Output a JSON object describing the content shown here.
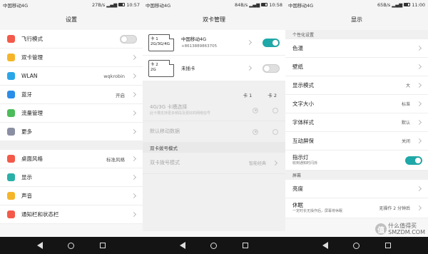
{
  "screen1": {
    "status": {
      "carrier": "中国移动4G",
      "speed": "27B/s",
      "time": "10:57"
    },
    "title": "设置",
    "group1": [
      {
        "label": "飞行模式",
        "icon": "airplane-icon",
        "color": "#f35a4a",
        "toggle": "off"
      },
      {
        "label": "双卡管理",
        "icon": "sim-icon",
        "color": "#f5b52a"
      },
      {
        "label": "WLAN",
        "value": "wqkrobin",
        "icon": "wifi-icon",
        "color": "#2aa6e8"
      },
      {
        "label": "蓝牙",
        "value": "开启",
        "icon": "bluetooth-icon",
        "color": "#2a8ee8"
      },
      {
        "label": "流量管理",
        "icon": "data-usage-icon",
        "color": "#4cbb5a"
      },
      {
        "label": "更多",
        "icon": "more-icon",
        "color": "#8a8fa3"
      }
    ],
    "group2": [
      {
        "label": "桌面风格",
        "value": "标准风格",
        "icon": "home-style-icon",
        "color": "#f35a4a"
      },
      {
        "label": "显示",
        "icon": "display-icon",
        "color": "#2ab0a8"
      },
      {
        "label": "声音",
        "icon": "sound-icon",
        "color": "#f5b52a"
      },
      {
        "label": "通知栏和状态栏",
        "icon": "notification-icon",
        "color": "#f35a4a"
      }
    ]
  },
  "screen2": {
    "status": {
      "speed": "84B/s",
      "time": "10:58"
    },
    "title": "双卡管理",
    "sim1": {
      "card": "卡 1",
      "type": "2G/3G/4G",
      "name": "中国移动4G",
      "number": "+8613889863705",
      "toggle": "on"
    },
    "sim2": {
      "card": "卡 2",
      "type": "2G",
      "name": "未插卡",
      "toggle": "off"
    },
    "col1": "卡 1",
    "col2": "卡 2",
    "slot_title": "4G/3G 卡槽选择",
    "slot_sub": "此卡槽支持更多频段及更好的网络信号",
    "default_data": "默认移动数据",
    "dial_section": "双卡拨号模式",
    "dial_label": "双卡拨号模式",
    "dial_value": "智能经典"
  },
  "screen3": {
    "status": {
      "speed": "65B/s",
      "time": "11:00"
    },
    "title": "显示",
    "section1": "个性化设置",
    "items1": [
      {
        "label": "色温"
      },
      {
        "label": "壁纸"
      },
      {
        "label": "显示模式",
        "value": "大"
      },
      {
        "label": "文字大小",
        "value": "标准"
      },
      {
        "label": "字体样式",
        "value": "默认"
      },
      {
        "label": "互动屏保",
        "value": "关闭"
      }
    ],
    "indicator": {
      "label": "指示灯",
      "sub": "收到通知时闪烁",
      "toggle": "on"
    },
    "section2": "屏幕",
    "brightness": "亮度",
    "sleep": {
      "label": "休眠",
      "sub": "一定时长无操作后，屏幕将休眠",
      "value": "无操作 2 分钟后"
    }
  },
  "watermark": {
    "logo": "值",
    "line1": "什么值得买",
    "line2": "SMZDM.COM"
  }
}
